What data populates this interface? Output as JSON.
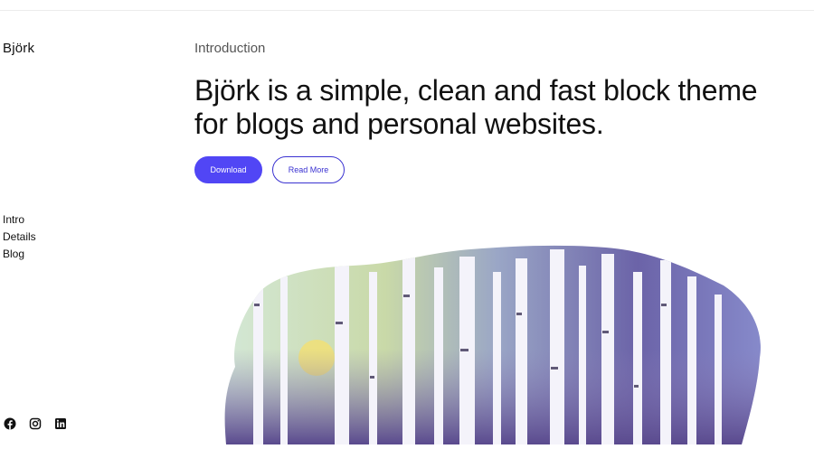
{
  "site": {
    "title": "Björk"
  },
  "nav": {
    "items": [
      {
        "label": "Intro"
      },
      {
        "label": "Details"
      },
      {
        "label": "Blog"
      }
    ]
  },
  "social": {
    "icons": [
      "facebook-icon",
      "instagram-icon",
      "linkedin-icon"
    ]
  },
  "hero": {
    "eyebrow": "Introduction",
    "headline": "Björk is a simple, clean and fast block theme for blogs and personal websites.",
    "primary_button": "Download",
    "secondary_button": "Read More",
    "image_description_icon": "birch-forest-illustration"
  },
  "colors": {
    "accent": "#5146f5",
    "accent_dark": "#3a32d1",
    "text": "#111111",
    "muted": "#555555"
  }
}
